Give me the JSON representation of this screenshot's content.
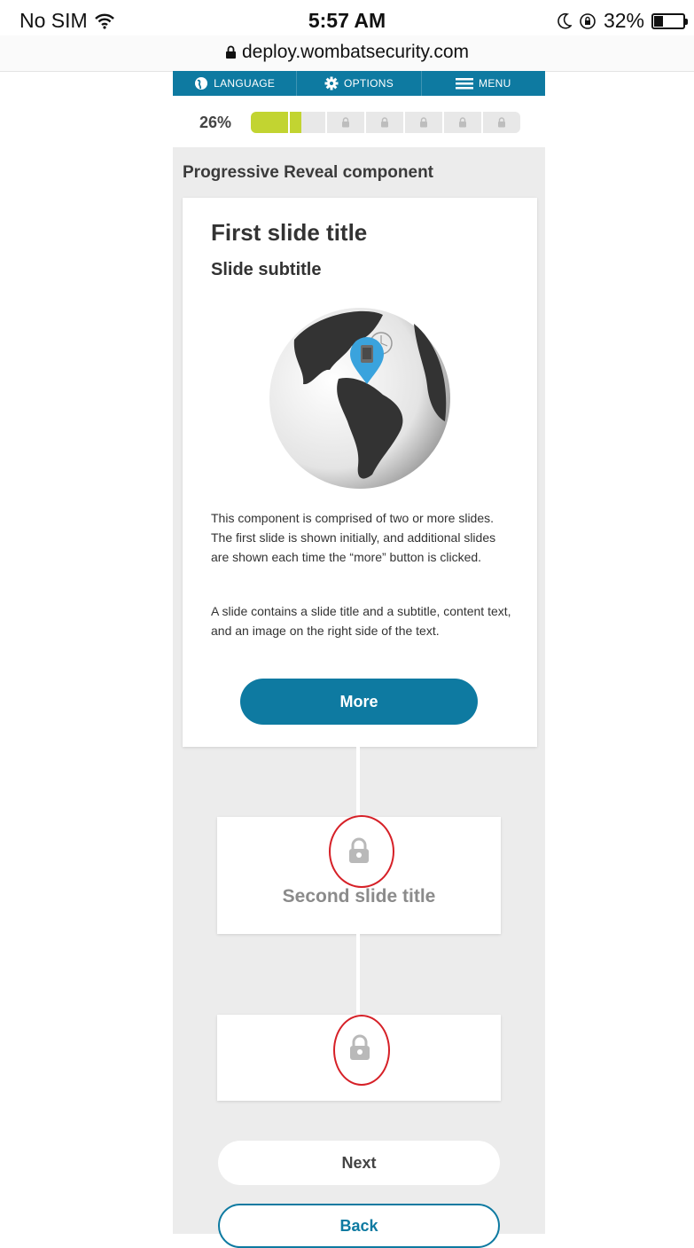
{
  "status_bar": {
    "carrier": "No SIM",
    "time": "5:57 AM",
    "battery": "32%",
    "battery_level": 0.32
  },
  "browser": {
    "url": "deploy.wombatsecurity.com"
  },
  "nav": {
    "language": "LANGUAGE",
    "options": "OPTIONS",
    "menu": "MENU"
  },
  "progress": {
    "percent_label": "26%",
    "value": 0.26,
    "segments_total": 7,
    "segments_completed": 1
  },
  "component": {
    "title": "Progressive Reveal component"
  },
  "slide1": {
    "title": "First slide title",
    "subtitle": "Slide subtitle",
    "paragraph1": "This component is comprised of two or more slides. The first slide is shown initially, and additional slides are shown each time the “more” button is clicked.",
    "paragraph2": "A slide contains a slide title and a subtitle, content text, and an image on the right side of the text.",
    "more_label": "More"
  },
  "slide2": {
    "title": "Second slide title"
  },
  "buttons": {
    "next": "Next",
    "back": "Back"
  },
  "colors": {
    "nav_bg": "#0e7aa1",
    "progress_done": "#c2d431",
    "locked": "#e8e8e8",
    "annotation_ring": "#d62027"
  }
}
